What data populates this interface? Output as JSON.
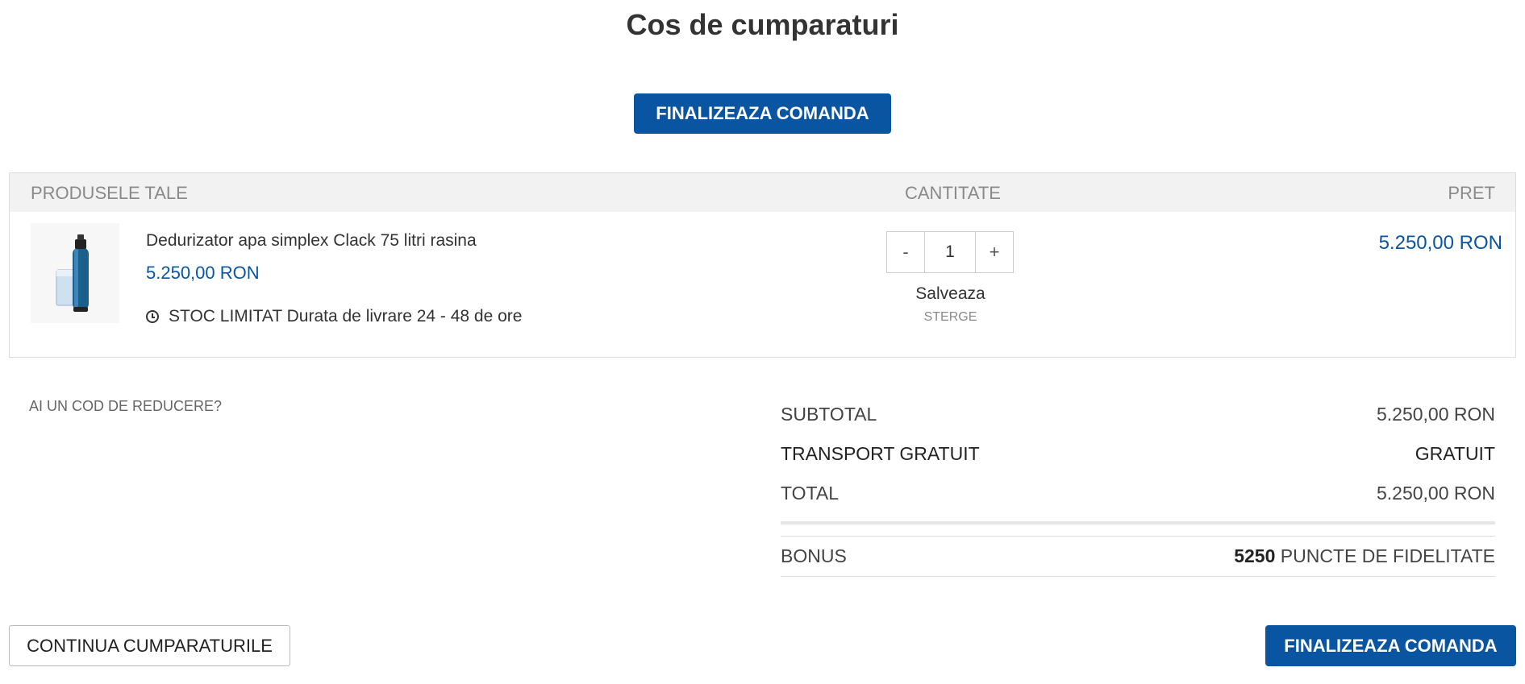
{
  "page": {
    "title": "Cos de cumparaturi"
  },
  "checkout_top": {
    "label": "FINALIZEAZA COMANDA"
  },
  "table": {
    "headers": {
      "products": "PRODUSELE TALE",
      "quantity": "CANTITATE",
      "price": "PRET"
    },
    "items": [
      {
        "name": "Dedurizator apa simplex Clack 75 litri rasina",
        "unit_price": "5.250,00 RON",
        "stock_status": "STOC LIMITAT",
        "delivery": "Durata de livrare 24 - 48 de ore",
        "quantity": "1",
        "decrement": "-",
        "increment": "+",
        "save_label": "Salveaza",
        "delete_label": "STERGE",
        "total_price": "5.250,00 RON",
        "icon": "clock-icon"
      }
    ]
  },
  "discount": {
    "label": "AI UN COD DE REDUCERE?"
  },
  "summary": {
    "subtotal_label": "SUBTOTAL",
    "subtotal_value": "5.250,00 RON",
    "transport_label": "TRANSPORT GRATUIT",
    "transport_value": "GRATUIT",
    "total_label": "TOTAL",
    "total_value": "5.250,00 RON",
    "bonus_label": "BONUS",
    "bonus_points": "5250",
    "bonus_suffix": "PUNCTE DE FIDELITATE"
  },
  "footer": {
    "continue_label": "CONTINUA CUMPARATURILE",
    "checkout_label": "FINALIZEAZA COMANDA"
  },
  "colors": {
    "accent": "#0a55a1",
    "header_bg": "#f2f2f2"
  }
}
